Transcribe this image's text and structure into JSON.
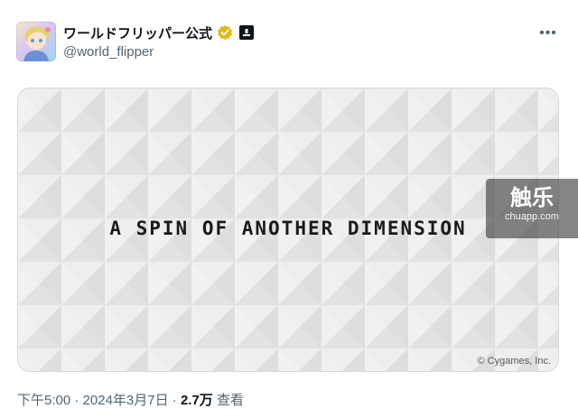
{
  "author": {
    "display_name": "ワールドフリッパー公式",
    "handle": "@world_flipper",
    "verified_color": "#e2b719"
  },
  "more_icon": "more-horizontal-icon",
  "media": {
    "headline": "A SPIN OF ANOTHER DIMENSION",
    "copyright": "© Cygames, Inc."
  },
  "watermark": {
    "big": "触乐",
    "small": "chuapp.com"
  },
  "meta": {
    "time": "下午5:00",
    "separator1": " · ",
    "date": "2024年3月7日",
    "separator2": " · ",
    "views": "2.7万",
    "views_label": " 查看"
  }
}
